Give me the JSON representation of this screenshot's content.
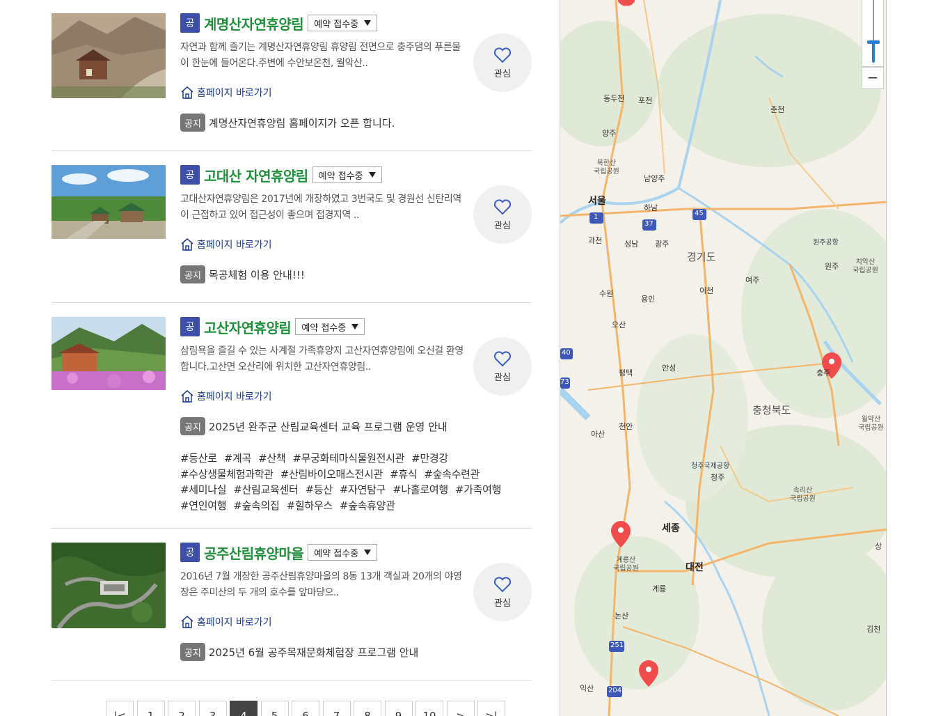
{
  "items": [
    {
      "badge": "공",
      "title": "계명산자연휴양림",
      "status": "예약 접수중",
      "desc": "자연과 함께 즐기는 계명산자연휴양림 휴양림 전면으로 충주댐의 푸른물이 한눈에 들어온다.주변에 수안보온천, 월악산..",
      "homepage": "홈페이지 바로가기",
      "notice_badge": "공지",
      "notice": "계명산자연휴양림 홈페이지가 오픈 합니다.",
      "fav": "관심",
      "tags": []
    },
    {
      "badge": "공",
      "title": "고대산 자연휴양림",
      "status": "예약 접수중",
      "desc": "고대산자연휴양림은 2017년에 개장하였고 3번국도 및 경원선 신탄리역이 근접하고 있어 접근성이 좋으며 접경지역 ..",
      "homepage": "홈페이지 바로가기",
      "notice_badge": "공지",
      "notice": "목공체험 이용 안내!!!",
      "fav": "관심",
      "tags": []
    },
    {
      "badge": "공",
      "title": "고산자연휴양림",
      "status": "예약 접수중",
      "desc": "삼림욕을 즐길 수 있는 사계절 가족휴양지 고산자연휴양림에 오신걸 환영합니다.고산면 오산리에 위치한 고산자연휴양림..",
      "homepage": "홈페이지 바로가기",
      "notice_badge": "공지",
      "notice": "2025년 완주군 산림교육센터 교육 프로그램 운영 안내",
      "fav": "관심",
      "tags": [
        "#등산로",
        "#계곡",
        "#산책",
        "#무궁화테마식물원전시관",
        "#만경강",
        "#수상생물체험과학관",
        "#산림바이오매스전시관",
        "#휴식",
        "#숲속수련관",
        "#세미나실",
        "#산림교육센터",
        "#등산",
        "#자연탐구",
        "#나홀로여행",
        "#가족여행",
        "#연인여행",
        "#숲속의집",
        "#힐하우스",
        "#숲속휴양관"
      ]
    },
    {
      "badge": "공",
      "title": "공주산림휴양마을",
      "status": "예약 접수중",
      "desc": "2016년 7월 개장한 공주산림휴양마을의 8동 13개 객실과 20개의 야영장은 주미산의 두 개의 호수를 앞마당으..",
      "homepage": "홈페이지 바로가기",
      "notice_badge": "공지",
      "notice": "2025년 6월 공주목재문화체험장 프로그램 안내",
      "fav": "관심",
      "tags": []
    }
  ],
  "pagination": {
    "first_icon": "first-page-icon",
    "prev_icon": "prev-page-icon",
    "pages": [
      "1",
      "2",
      "3",
      "4",
      "5",
      "6",
      "7",
      "8",
      "9",
      "10"
    ],
    "current": "4",
    "next_icon": "next-page-icon",
    "last_icon": "last-page-icon"
  },
  "map": {
    "cities": [
      "동두천",
      "포천",
      "춘천",
      "양주",
      "남양주",
      "서울",
      "하남",
      "과천",
      "성남",
      "광주",
      "수원",
      "용인",
      "이천",
      "여주",
      "원주",
      "오산",
      "안성",
      "평택",
      "충주",
      "천안",
      "아산",
      "청주",
      "세종",
      "대전",
      "계룡",
      "논산",
      "김천",
      "익산",
      "원주공항",
      "청주국제공항",
      "상"
    ],
    "regions": [
      "경기도",
      "충청북도"
    ],
    "parks": [
      "북한산\n국립공원",
      "치악산\n국립공원",
      "월악산\n국립공원",
      "속리산\n국립공원",
      "계룡산\n국립공원"
    ],
    "road_numbers": [
      "1",
      "37",
      "45",
      "40",
      "73",
      "251",
      "204"
    ],
    "zoom_out_label": "−",
    "colors": {
      "marker": "#f04c4c",
      "water": "#a9d3ee",
      "road": "#f4b56a",
      "forest": "#d4e6cd"
    }
  }
}
